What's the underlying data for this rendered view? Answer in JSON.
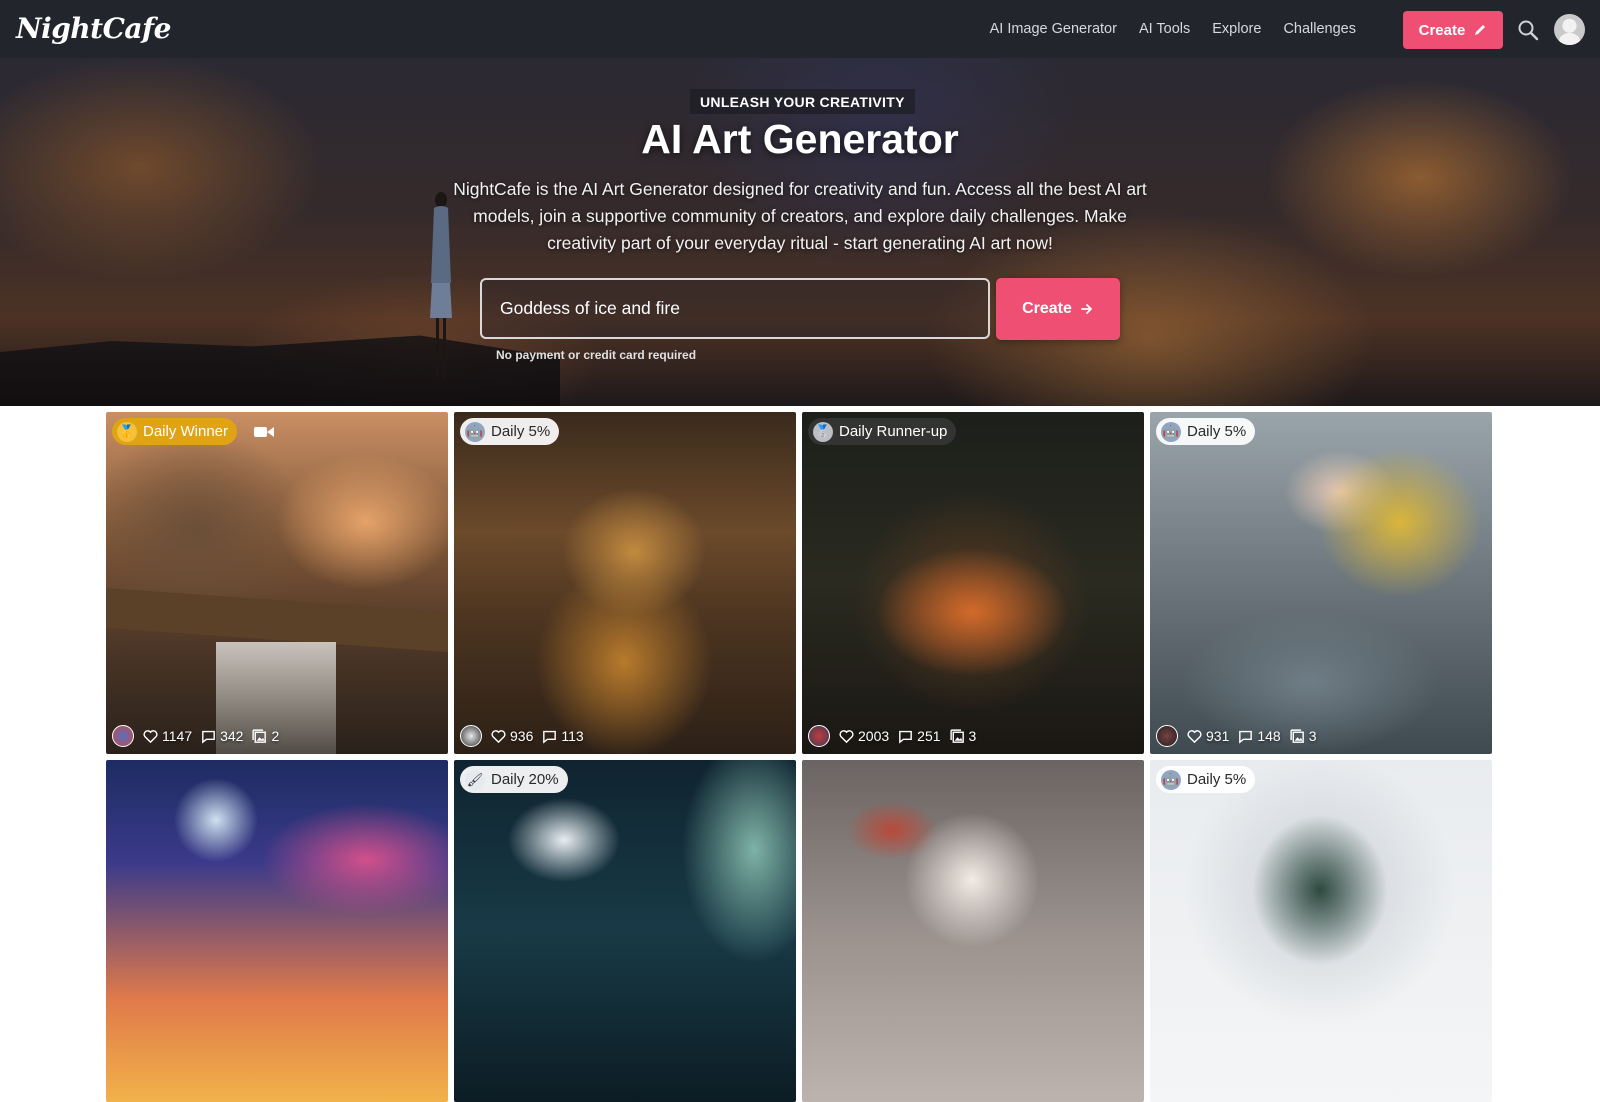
{
  "nav": {
    "logo": "NightCafe",
    "links": [
      "AI Image Generator",
      "AI Tools",
      "Explore",
      "Challenges"
    ],
    "create_label": "Create",
    "search_icon": "search-icon",
    "avatar_icon": "user-avatar-icon"
  },
  "hero": {
    "eyebrow": "UNLEASH YOUR CREATIVITY",
    "title": "AI Art Generator",
    "description": "NightCafe is the AI Art Generator designed for creativity and fun. Access all the best AI art models, join a supportive community of creators, and explore daily challenges. Make creativity part of your everyday ritual - start generating AI art now!",
    "prompt_value": "Goddess of ice and fire",
    "create_label": "Create",
    "note": "No payment or credit card required"
  },
  "colors": {
    "accent": "#ee4f72",
    "nav_bg": "#22262c",
    "gold": "#e0a313"
  },
  "gallery": [
    {
      "badge": "Daily Winner",
      "badge_style": "gold",
      "badge_icon": "medal-icon",
      "video": true,
      "likes": "1147",
      "comments": "342",
      "images": "2"
    },
    {
      "badge": "Daily 5%",
      "badge_style": "light",
      "badge_icon": "robot-icon",
      "video": false,
      "likes": "936",
      "comments": "113",
      "images": ""
    },
    {
      "badge": "Daily Runner-up",
      "badge_style": "dark",
      "badge_icon": "silver-medal-icon",
      "video": false,
      "likes": "2003",
      "comments": "251",
      "images": "3"
    },
    {
      "badge": "Daily 5%",
      "badge_style": "light",
      "badge_icon": "robot-icon",
      "video": false,
      "likes": "931",
      "comments": "148",
      "images": "3"
    },
    {
      "badge": "",
      "badge_style": "",
      "badge_icon": "",
      "video": false,
      "likes": "",
      "comments": "",
      "images": ""
    },
    {
      "badge": "Daily 20%",
      "badge_style": "light",
      "badge_icon": "paintbrush-icon",
      "video": false,
      "likes": "",
      "comments": "",
      "images": ""
    },
    {
      "badge": "",
      "badge_style": "",
      "badge_icon": "",
      "video": false,
      "likes": "",
      "comments": "",
      "images": ""
    },
    {
      "badge": "Daily 5%",
      "badge_style": "light",
      "badge_icon": "robot-icon",
      "video": false,
      "likes": "",
      "comments": "",
      "images": ""
    }
  ]
}
